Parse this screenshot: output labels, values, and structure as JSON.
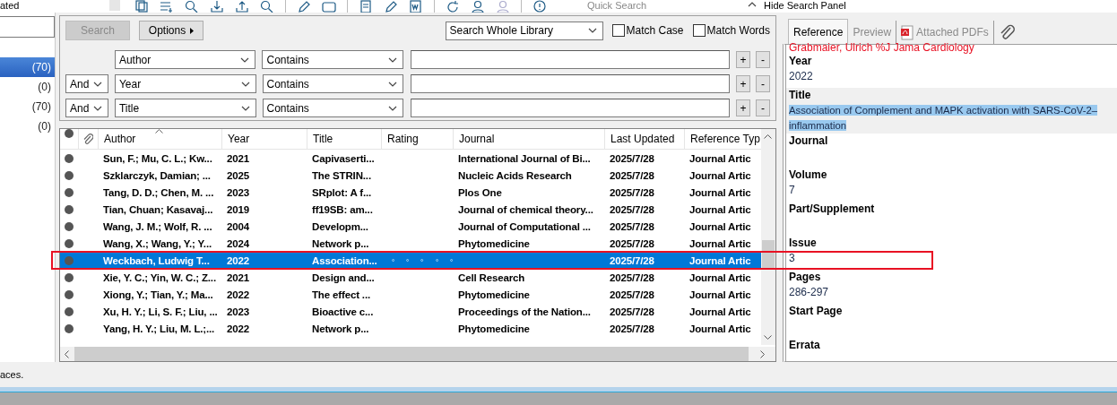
{
  "toolbar": {
    "group_label": "ated",
    "quick_search": {
      "placeholder": "Quick Search"
    },
    "hide_panel_label": "Hide Search Panel"
  },
  "sidebar": {
    "items": [
      {
        "count": "(70)",
        "selected": true
      },
      {
        "count": "(0)",
        "selected": false
      },
      {
        "count": "(70)",
        "selected": false
      },
      {
        "count": "(0)",
        "selected": false
      }
    ]
  },
  "search_panel": {
    "search_button": {
      "label": "Search",
      "disabled": true
    },
    "options_button": "Options",
    "scope": "Search Whole Library",
    "match_case": {
      "label": "Match Case",
      "checked": false
    },
    "match_words": {
      "label": "Match Words",
      "checked": false
    },
    "criteria": [
      {
        "field": "Author",
        "operator": "Contains",
        "add": "+",
        "remove": "-"
      },
      {
        "connector": "And",
        "field": "Year",
        "operator": "Contains",
        "add": "+",
        "remove": "-"
      },
      {
        "connector": "And",
        "field": "Title",
        "operator": "Contains",
        "add": "+",
        "remove": "-"
      }
    ]
  },
  "table": {
    "columns": [
      {
        "kind": "read"
      },
      {
        "kind": "attachment"
      },
      {
        "kind": "text",
        "label": "Author",
        "sorted": true
      },
      {
        "kind": "text",
        "label": "Year",
        "sorted": false
      },
      {
        "kind": "text",
        "label": "Title",
        "sorted": false
      },
      {
        "kind": "text",
        "label": "Rating",
        "sorted": false
      },
      {
        "kind": "text",
        "label": "Journal",
        "sorted": false
      },
      {
        "kind": "text",
        "label": "Last Updated",
        "sorted": false
      },
      {
        "kind": "text",
        "label": "Reference Typ",
        "sorted": false
      }
    ],
    "rows": [
      {
        "author": "Sun, F.; Mu, C. L.; Kw...",
        "year": "2021",
        "title": "Capivaserti...",
        "journal": "International Journal of Bi...",
        "updated": "2025/7/28",
        "type": "Journal Artic",
        "selected": false
      },
      {
        "author": "Szklarczyk, Damian; ...",
        "year": "2025",
        "title": "The STRIN...",
        "journal": "Nucleic Acids Research",
        "updated": "2025/7/28",
        "type": "Journal Artic",
        "selected": false
      },
      {
        "author": "Tang, D. D.; Chen, M. ...",
        "year": "2023",
        "title": "SRplot: A f...",
        "journal": "Plos One",
        "updated": "2025/7/28",
        "type": "Journal Artic",
        "selected": false
      },
      {
        "author": "Tian, Chuan; Kasavaj...",
        "year": "2019",
        "title": "ff19SB: am...",
        "journal": "Journal of chemical theory...",
        "updated": "2025/7/28",
        "type": "Journal Artic",
        "selected": false
      },
      {
        "author": "Wang, J. M.; Wolf, R. ...",
        "year": "2004",
        "title": "Developm...",
        "journal": "Journal of Computational ...",
        "updated": "2025/7/28",
        "type": "Journal Artic",
        "selected": false
      },
      {
        "author": "Wang, X.; Wang, Y.; Y...",
        "year": "2024",
        "title": "Network p...",
        "journal": "Phytomedicine",
        "updated": "2025/7/28",
        "type": "Journal Artic",
        "selected": false
      },
      {
        "author": "Weckbach, Ludwig T...",
        "year": "2022",
        "title": "Association...",
        "rating": {
          "stars": 0
        },
        "updated": "2025/7/28",
        "type": "Journal Artic",
        "selected": true
      },
      {
        "author": "Xie, Y. C.; Yin, W. C.; Z...",
        "year": "2021",
        "title": "Design and...",
        "journal": "Cell Research",
        "updated": "2025/7/28",
        "type": "Journal Artic",
        "selected": false
      },
      {
        "author": "Xiong, Y.; Tian, Y.; Ma...",
        "year": "2022",
        "title": "The effect ...",
        "journal": "Phytomedicine",
        "updated": "2025/7/28",
        "type": "Journal Artic",
        "selected": false
      },
      {
        "author": "Xu, H. Y.; Li, S. F.; Liu, ...",
        "year": "2023",
        "title": "Bioactive c...",
        "journal": "Proceedings of the Nation...",
        "updated": "2025/7/28",
        "type": "Journal Artic",
        "selected": false
      },
      {
        "author": "Yang, H. Y.; Liu, M. L.;...",
        "year": "2022",
        "title": "Network p...",
        "journal": "Phytomedicine",
        "updated": "2025/7/28",
        "type": "Journal Artic",
        "selected": false
      }
    ]
  },
  "reference_panel": {
    "tabs": [
      {
        "kind": "text",
        "label": "Reference",
        "selected": true
      },
      {
        "kind": "text",
        "label": "Preview",
        "selected": false
      },
      {
        "kind": "pdf",
        "label": "Attached PDFs",
        "selected": false
      },
      {
        "kind": "attachment",
        "selected": false
      }
    ],
    "overflow_text": "Grabmaier, Ulrich %J Jama Cardiology",
    "fields": [
      {
        "label": "Year",
        "value": [
          "2022"
        ],
        "focused": false
      },
      {
        "label": "Title",
        "value": [
          "Association of Complement and MAPK activation with SARS-CoV-2–",
          "inflammation"
        ],
        "focused": true
      },
      {
        "label": "Journal",
        "focused": false
      },
      {
        "label": "Volume",
        "value": [
          "7"
        ],
        "focused": false
      },
      {
        "label": "Part/Supplement",
        "focused": false
      },
      {
        "label": "Issue",
        "value": [
          "3"
        ],
        "focused": false
      },
      {
        "label": "Pages",
        "value": [
          "286-297"
        ],
        "focused": false
      },
      {
        "label": "Start Page",
        "focused": false
      },
      {
        "label": "Errata",
        "focused": false
      }
    ]
  },
  "status_bar": {
    "text": "aces."
  },
  "annotations": [
    {
      "kind": "rectangle"
    }
  ]
}
